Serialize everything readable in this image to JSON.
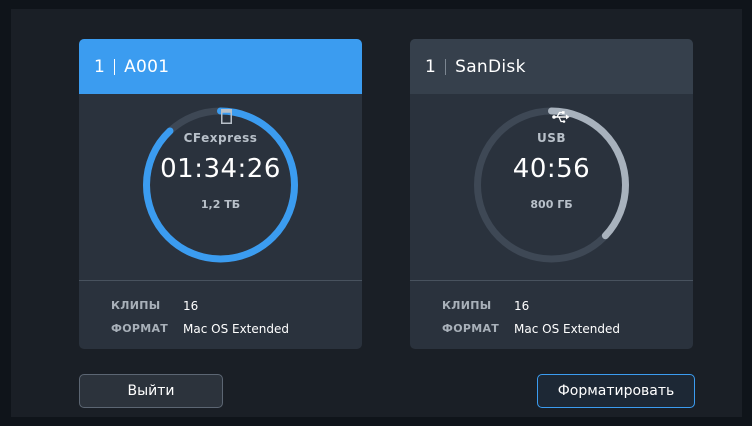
{
  "cards": [
    {
      "slot": "1",
      "name": "A001",
      "media_icon": "cfexpress-card-icon",
      "media_type": "CFexpress",
      "time": "01:34:26",
      "capacity": "1,2 ТБ",
      "fill_fraction": 0.88,
      "ring_color": "#3b9cf0",
      "info": [
        {
          "label": "КЛИПЫ",
          "value": "16"
        },
        {
          "label": "ФОРМАТ",
          "value": "Mac OS Extended"
        }
      ]
    },
    {
      "slot": "1",
      "name": "SanDisk",
      "media_icon": "usb-icon",
      "media_type": "USB",
      "time": "40:56",
      "capacity": "800 ГБ",
      "fill_fraction": 0.37,
      "ring_color": "#a8b2bd",
      "info": [
        {
          "label": "КЛИПЫ",
          "value": "16"
        },
        {
          "label": "ФОРМАТ",
          "value": "Mac OS Extended"
        }
      ]
    }
  ],
  "buttons": {
    "exit_label": "Выйти",
    "format_label": "Форматировать"
  },
  "colors": {
    "accent": "#3b9cf0",
    "card_bg": "#2a323d",
    "screen_bg": "#1a1f26"
  }
}
